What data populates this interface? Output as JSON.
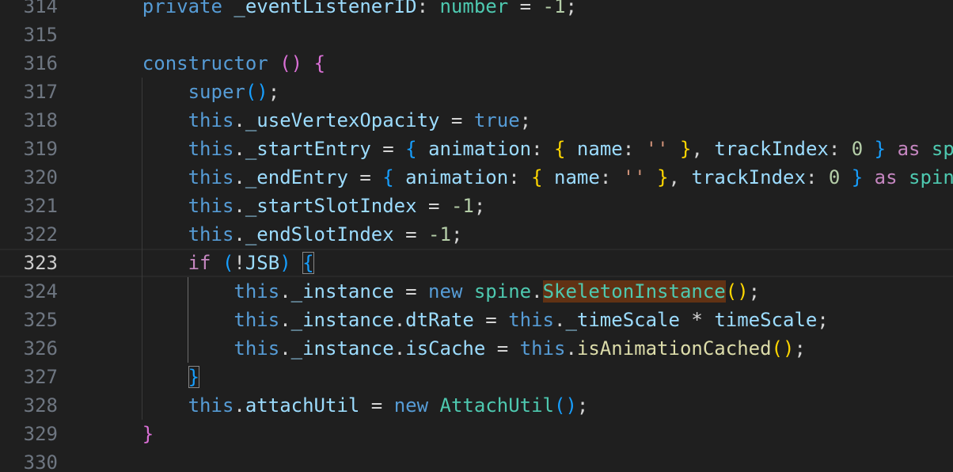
{
  "editor": {
    "lines": [
      {
        "number": "314",
        "indent": 1,
        "tokens": [
          {
            "t": "private ",
            "c": "kw"
          },
          {
            "t": "_eventListenerID",
            "c": "prop"
          },
          {
            "t": ": ",
            "c": "pun"
          },
          {
            "t": "number",
            "c": "type"
          },
          {
            "t": " = ",
            "c": "pun"
          },
          {
            "t": "-1",
            "c": "num"
          },
          {
            "t": ";",
            "c": "pun"
          }
        ]
      },
      {
        "number": "315",
        "indent": 0,
        "tokens": []
      },
      {
        "number": "316",
        "indent": 1,
        "tokens": [
          {
            "t": "constructor",
            "c": "kw"
          },
          {
            "t": " ",
            "c": "pun"
          },
          {
            "t": "()",
            "c": "b2"
          },
          {
            "t": " ",
            "c": "pun"
          },
          {
            "t": "{",
            "c": "b2"
          }
        ]
      },
      {
        "number": "317",
        "indent": 2,
        "tokens": [
          {
            "t": "super",
            "c": "kw"
          },
          {
            "t": "()",
            "c": "b3"
          },
          {
            "t": ";",
            "c": "pun"
          }
        ]
      },
      {
        "number": "318",
        "indent": 2,
        "tokens": [
          {
            "t": "this",
            "c": "kw"
          },
          {
            "t": ".",
            "c": "pun"
          },
          {
            "t": "_useVertexOpacity",
            "c": "prop"
          },
          {
            "t": " = ",
            "c": "pun"
          },
          {
            "t": "true",
            "c": "kw"
          },
          {
            "t": ";",
            "c": "pun"
          }
        ]
      },
      {
        "number": "319",
        "indent": 2,
        "tokens": [
          {
            "t": "this",
            "c": "kw"
          },
          {
            "t": ".",
            "c": "pun"
          },
          {
            "t": "_startEntry",
            "c": "prop"
          },
          {
            "t": " = ",
            "c": "pun"
          },
          {
            "t": "{",
            "c": "b3"
          },
          {
            "t": " ",
            "c": "pun"
          },
          {
            "t": "animation",
            "c": "prop"
          },
          {
            "t": ": ",
            "c": "pun"
          },
          {
            "t": "{",
            "c": "b1"
          },
          {
            "t": " ",
            "c": "pun"
          },
          {
            "t": "name",
            "c": "prop"
          },
          {
            "t": ": ",
            "c": "pun"
          },
          {
            "t": "''",
            "c": "str"
          },
          {
            "t": " ",
            "c": "pun"
          },
          {
            "t": "}",
            "c": "b1"
          },
          {
            "t": ", ",
            "c": "pun"
          },
          {
            "t": "trackIndex",
            "c": "prop"
          },
          {
            "t": ": ",
            "c": "pun"
          },
          {
            "t": "0",
            "c": "num"
          },
          {
            "t": " ",
            "c": "pun"
          },
          {
            "t": "}",
            "c": "b3"
          },
          {
            "t": " ",
            "c": "pun"
          },
          {
            "t": "as",
            "c": "ctl"
          },
          {
            "t": " ",
            "c": "pun"
          },
          {
            "t": "sp",
            "c": "type"
          }
        ]
      },
      {
        "number": "320",
        "indent": 2,
        "tokens": [
          {
            "t": "this",
            "c": "kw"
          },
          {
            "t": ".",
            "c": "pun"
          },
          {
            "t": "_endEntry",
            "c": "prop"
          },
          {
            "t": " = ",
            "c": "pun"
          },
          {
            "t": "{",
            "c": "b3"
          },
          {
            "t": " ",
            "c": "pun"
          },
          {
            "t": "animation",
            "c": "prop"
          },
          {
            "t": ": ",
            "c": "pun"
          },
          {
            "t": "{",
            "c": "b1"
          },
          {
            "t": " ",
            "c": "pun"
          },
          {
            "t": "name",
            "c": "prop"
          },
          {
            "t": ": ",
            "c": "pun"
          },
          {
            "t": "''",
            "c": "str"
          },
          {
            "t": " ",
            "c": "pun"
          },
          {
            "t": "}",
            "c": "b1"
          },
          {
            "t": ", ",
            "c": "pun"
          },
          {
            "t": "trackIndex",
            "c": "prop"
          },
          {
            "t": ": ",
            "c": "pun"
          },
          {
            "t": "0",
            "c": "num"
          },
          {
            "t": " ",
            "c": "pun"
          },
          {
            "t": "}",
            "c": "b3"
          },
          {
            "t": " ",
            "c": "pun"
          },
          {
            "t": "as",
            "c": "ctl"
          },
          {
            "t": " ",
            "c": "pun"
          },
          {
            "t": "spin",
            "c": "type"
          }
        ]
      },
      {
        "number": "321",
        "indent": 2,
        "tokens": [
          {
            "t": "this",
            "c": "kw"
          },
          {
            "t": ".",
            "c": "pun"
          },
          {
            "t": "_startSlotIndex",
            "c": "prop"
          },
          {
            "t": " = ",
            "c": "pun"
          },
          {
            "t": "-1",
            "c": "num"
          },
          {
            "t": ";",
            "c": "pun"
          }
        ]
      },
      {
        "number": "322",
        "indent": 2,
        "tokens": [
          {
            "t": "this",
            "c": "kw"
          },
          {
            "t": ".",
            "c": "pun"
          },
          {
            "t": "_endSlotIndex",
            "c": "prop"
          },
          {
            "t": " = ",
            "c": "pun"
          },
          {
            "t": "-1",
            "c": "num"
          },
          {
            "t": ";",
            "c": "pun"
          }
        ]
      },
      {
        "number": "323",
        "indent": 2,
        "current": true,
        "tokens": [
          {
            "t": "if",
            "c": "ctl"
          },
          {
            "t": " ",
            "c": "pun"
          },
          {
            "t": "(",
            "c": "b3"
          },
          {
            "t": "!",
            "c": "pun"
          },
          {
            "t": "JSB",
            "c": "prop"
          },
          {
            "t": ")",
            "c": "b3"
          },
          {
            "t": " ",
            "c": "pun"
          },
          {
            "t": "{",
            "c": "b3",
            "m": true
          }
        ]
      },
      {
        "number": "324",
        "indent": 3,
        "tokens": [
          {
            "t": "this",
            "c": "kw"
          },
          {
            "t": ".",
            "c": "pun"
          },
          {
            "t": "_instance",
            "c": "prop"
          },
          {
            "t": " = ",
            "c": "pun"
          },
          {
            "t": "new",
            "c": "kw"
          },
          {
            "t": " ",
            "c": "pun"
          },
          {
            "t": "spine",
            "c": "type"
          },
          {
            "t": ".",
            "c": "pun"
          },
          {
            "t": "SkeletonInstance",
            "c": "type",
            "h": true
          },
          {
            "t": "()",
            "c": "b1"
          },
          {
            "t": ";",
            "c": "pun"
          }
        ]
      },
      {
        "number": "325",
        "indent": 3,
        "tokens": [
          {
            "t": "this",
            "c": "kw"
          },
          {
            "t": ".",
            "c": "pun"
          },
          {
            "t": "_instance",
            "c": "prop"
          },
          {
            "t": ".",
            "c": "pun"
          },
          {
            "t": "dtRate",
            "c": "prop"
          },
          {
            "t": " = ",
            "c": "pun"
          },
          {
            "t": "this",
            "c": "kw"
          },
          {
            "t": ".",
            "c": "pun"
          },
          {
            "t": "_timeScale",
            "c": "prop"
          },
          {
            "t": " * ",
            "c": "pun"
          },
          {
            "t": "timeScale",
            "c": "prop"
          },
          {
            "t": ";",
            "c": "pun"
          }
        ]
      },
      {
        "number": "326",
        "indent": 3,
        "tokens": [
          {
            "t": "this",
            "c": "kw"
          },
          {
            "t": ".",
            "c": "pun"
          },
          {
            "t": "_instance",
            "c": "prop"
          },
          {
            "t": ".",
            "c": "pun"
          },
          {
            "t": "isCache",
            "c": "prop"
          },
          {
            "t": " = ",
            "c": "pun"
          },
          {
            "t": "this",
            "c": "kw"
          },
          {
            "t": ".",
            "c": "pun"
          },
          {
            "t": "isAnimationCached",
            "c": "fn"
          },
          {
            "t": "()",
            "c": "b1"
          },
          {
            "t": ";",
            "c": "pun"
          }
        ]
      },
      {
        "number": "327",
        "indent": 2,
        "tokens": [
          {
            "t": "}",
            "c": "b3",
            "m": true
          }
        ]
      },
      {
        "number": "328",
        "indent": 2,
        "tokens": [
          {
            "t": "this",
            "c": "kw"
          },
          {
            "t": ".",
            "c": "pun"
          },
          {
            "t": "attachUtil",
            "c": "prop"
          },
          {
            "t": " = ",
            "c": "pun"
          },
          {
            "t": "new",
            "c": "kw"
          },
          {
            "t": " ",
            "c": "pun"
          },
          {
            "t": "AttachUtil",
            "c": "type"
          },
          {
            "t": "()",
            "c": "b3"
          },
          {
            "t": ";",
            "c": "pun"
          }
        ]
      },
      {
        "number": "329",
        "indent": 1,
        "tokens": [
          {
            "t": "}",
            "c": "b2"
          }
        ]
      },
      {
        "number": "330",
        "indent": 0,
        "tokens": []
      }
    ]
  }
}
